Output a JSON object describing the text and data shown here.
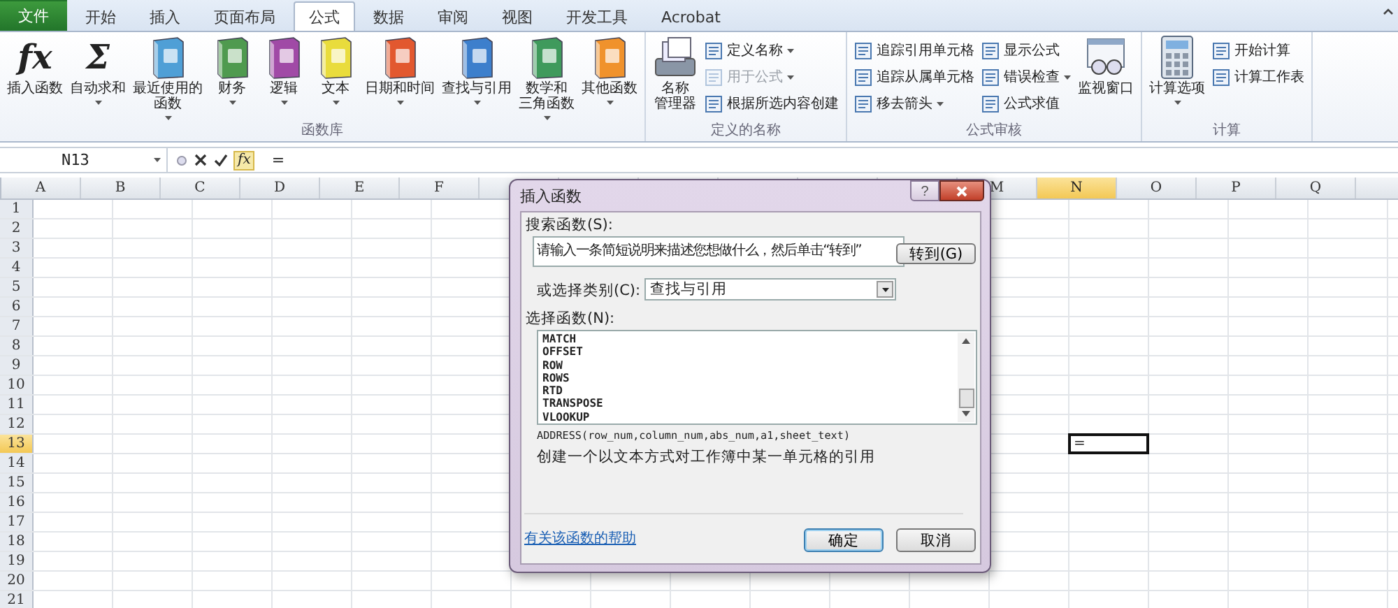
{
  "tabs": [
    {
      "label": "文件",
      "kind": "file",
      "selected": false
    },
    {
      "label": "开始",
      "kind": "tab",
      "selected": false
    },
    {
      "label": "插入",
      "kind": "tab",
      "selected": false
    },
    {
      "label": "页面布局",
      "kind": "tab",
      "selected": false
    },
    {
      "label": "公式",
      "kind": "tab",
      "selected": true
    },
    {
      "label": "数据",
      "kind": "tab",
      "selected": false
    },
    {
      "label": "审阅",
      "kind": "tab",
      "selected": false
    },
    {
      "label": "视图",
      "kind": "tab",
      "selected": false
    },
    {
      "label": "开发工具",
      "kind": "tab",
      "selected": false
    },
    {
      "label": "Acrobat",
      "kind": "tab",
      "selected": false
    }
  ],
  "ribbon": {
    "groups": [
      {
        "label": "函数库",
        "items": [
          {
            "kind": "glyph",
            "glyph": "fx",
            "lines": [
              "插入函数"
            ],
            "dropdown": false
          },
          {
            "kind": "glyph",
            "glyph": "Σ",
            "lines": [
              "自动求和"
            ],
            "dropdown": true
          },
          {
            "kind": "book",
            "color": "#4f9fd6",
            "lines": [
              "最近使用的",
              "函数"
            ],
            "dropdown": true
          },
          {
            "kind": "book",
            "color": "#4f9a4f",
            "lines": [
              "财务"
            ],
            "dropdown": true
          },
          {
            "kind": "book",
            "color": "#a04aa6",
            "lines": [
              "逻辑"
            ],
            "dropdown": true
          },
          {
            "kind": "book",
            "color": "#e9dc3c",
            "lines": [
              "文本"
            ],
            "dropdown": true
          },
          {
            "kind": "book",
            "color": "#e2582f",
            "lines": [
              "日期和时间"
            ],
            "dropdown": true
          },
          {
            "kind": "book",
            "color": "#3d7fcc",
            "lines": [
              "查找与引用"
            ],
            "dropdown": true
          },
          {
            "kind": "book",
            "color": "#3f9a5c",
            "lines": [
              "数学和",
              "三角函数"
            ],
            "dropdown": true
          },
          {
            "kind": "book",
            "color": "#f0922c",
            "lines": [
              "其他函数"
            ],
            "dropdown": true
          }
        ]
      },
      {
        "label": "定义的名称",
        "items": [
          {
            "kind": "cards",
            "lines": [
              "名称",
              "管理器"
            ],
            "dropdown": false
          },
          {
            "kind": "stack",
            "buttons": [
              {
                "label": "定义名称",
                "dropdown": true,
                "disabled": false
              },
              {
                "label": "用于公式",
                "dropdown": true,
                "disabled": true
              },
              {
                "label": "根据所选内容创建",
                "dropdown": false,
                "disabled": false
              }
            ]
          }
        ]
      },
      {
        "label": "公式审核",
        "items": [
          {
            "kind": "stack",
            "buttons": [
              {
                "label": "追踪引用单元格",
                "dropdown": false,
                "disabled": false
              },
              {
                "label": "追踪从属单元格",
                "dropdown": false,
                "disabled": false
              },
              {
                "label": "移去箭头",
                "dropdown": true,
                "disabled": false
              }
            ]
          },
          {
            "kind": "stack",
            "buttons": [
              {
                "label": "显示公式",
                "dropdown": false,
                "disabled": false
              },
              {
                "label": "错误检查",
                "dropdown": true,
                "disabled": false
              },
              {
                "label": "公式求值",
                "dropdown": false,
                "disabled": false
              }
            ]
          },
          {
            "kind": "watch",
            "lines": [
              "监视窗口"
            ],
            "dropdown": false
          }
        ]
      },
      {
        "label": "计算",
        "items": [
          {
            "kind": "calculator",
            "lines": [
              "计算选项"
            ],
            "dropdown": true
          },
          {
            "kind": "stack",
            "buttons": [
              {
                "label": "开始计算",
                "dropdown": false,
                "disabled": false
              },
              {
                "label": "计算工作表",
                "dropdown": false,
                "disabled": false
              }
            ]
          }
        ]
      }
    ]
  },
  "formula_bar": {
    "name_box": "N13",
    "fx": "fx",
    "formula": "="
  },
  "sheet": {
    "columns": [
      {
        "label": "A",
        "selected": false
      },
      {
        "label": "B",
        "selected": false
      },
      {
        "label": "C",
        "selected": false
      },
      {
        "label": "D",
        "selected": false
      },
      {
        "label": "E",
        "selected": false
      },
      {
        "label": "F",
        "selected": false
      },
      {
        "label": "M",
        "selected": false
      },
      {
        "label": "N",
        "selected": true
      },
      {
        "label": "O",
        "selected": false
      },
      {
        "label": "P",
        "selected": false
      },
      {
        "label": "Q",
        "selected": false
      }
    ],
    "rows": [
      {
        "label": "1",
        "selected": false
      },
      {
        "label": "2",
        "selected": false
      },
      {
        "label": "3",
        "selected": false
      },
      {
        "label": "4",
        "selected": false
      },
      {
        "label": "5",
        "selected": false
      },
      {
        "label": "6",
        "selected": false
      },
      {
        "label": "7",
        "selected": false
      },
      {
        "label": "8",
        "selected": false
      },
      {
        "label": "9",
        "selected": false
      },
      {
        "label": "10",
        "selected": false
      },
      {
        "label": "11",
        "selected": false
      },
      {
        "label": "12",
        "selected": false
      },
      {
        "label": "13",
        "selected": true
      },
      {
        "label": "14",
        "selected": false
      },
      {
        "label": "15",
        "selected": false
      },
      {
        "label": "16",
        "selected": false
      },
      {
        "label": "17",
        "selected": false
      },
      {
        "label": "18",
        "selected": false
      },
      {
        "label": "19",
        "selected": false
      },
      {
        "label": "20",
        "selected": false
      },
      {
        "label": "21",
        "selected": false
      }
    ],
    "active_cell": {
      "value": "="
    }
  },
  "dialog": {
    "title": "插入函数",
    "help_glyph": "?",
    "search_label": "搜索函数(S):",
    "search_value": "请输入一条简短说明来描述您想做什么，然后单击“转到”",
    "go_button": "转到(G)",
    "category_label": "或选择类别(C):",
    "category_value": "查找与引用",
    "function_label": "选择函数(N):",
    "functions": [
      "MATCH",
      "OFFSET",
      "ROW",
      "ROWS",
      "RTD",
      "TRANSPOSE",
      "VLOOKUP"
    ],
    "signature": "ADDRESS(row_num,column_num,abs_num,a1,sheet_text)",
    "description": "创建一个以文本方式对工作簿中某一单元格的引用",
    "help_link": "有关该函数的帮助",
    "buttons": [
      {
        "label": "确定",
        "default": true
      },
      {
        "label": "取消",
        "default": false
      }
    ]
  }
}
